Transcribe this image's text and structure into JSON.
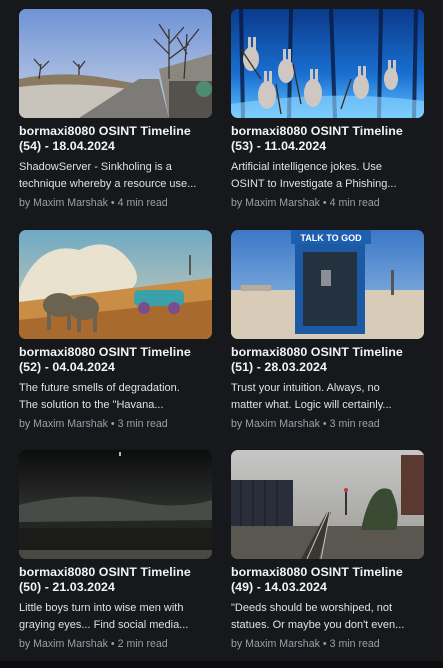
{
  "cards": [
    {
      "title_line1": "bormaxi8080 OSINT Timeline",
      "title_line2": "(54) - 18.04.2024",
      "excerpt_line1": "ShadowServer - Sinkholing is a",
      "excerpt_line2": "technique whereby a resource use...",
      "author": "by Maxim Marshak",
      "separator": "•",
      "read_time": "4 min read"
    },
    {
      "title_line1": "bormaxi8080 OSINT Timeline",
      "title_line2": "(53) - 11.04.2024",
      "excerpt_line1": "Artificial intelligence jokes. Use",
      "excerpt_line2": "OSINT to Investigate a Phishing...",
      "author": "by Maxim Marshak",
      "separator": "•",
      "read_time": "4 min read"
    },
    {
      "title_line1": "bormaxi8080 OSINT Timeline",
      "title_line2": "(52) - 04.04.2024",
      "excerpt_line1": "The future smells of degradation.",
      "excerpt_line2": "The solution to the \"Havana...",
      "author": "by Maxim Marshak",
      "separator": "•",
      "read_time": "3 min read"
    },
    {
      "title_line1": "bormaxi8080 OSINT Timeline",
      "title_line2": "(51) - 28.03.2024",
      "excerpt_line1": "Trust your intuition. Always, no",
      "excerpt_line2": "matter what. Logic will certainly...",
      "author": "by Maxim Marshak",
      "separator": "•",
      "read_time": "3 min read",
      "image_sign": "TALK TO GOD"
    },
    {
      "title_line1": "bormaxi8080 OSINT Timeline",
      "title_line2": "(50) - 21.03.2024",
      "excerpt_line1": "Little boys turn into wise men with",
      "excerpt_line2": "graying eyes... Find social media...",
      "author": "by Maxim Marshak",
      "separator": "•",
      "read_time": "2 min read"
    },
    {
      "title_line1": "bormaxi8080 OSINT Timeline",
      "title_line2": "(49) - 14.03.2024",
      "excerpt_line1": "\"Deeds should be worshiped, not",
      "excerpt_line2": "statues. Or maybe you don't even...",
      "author": "by Maxim Marshak",
      "separator": "•",
      "read_time": "3 min read"
    }
  ]
}
